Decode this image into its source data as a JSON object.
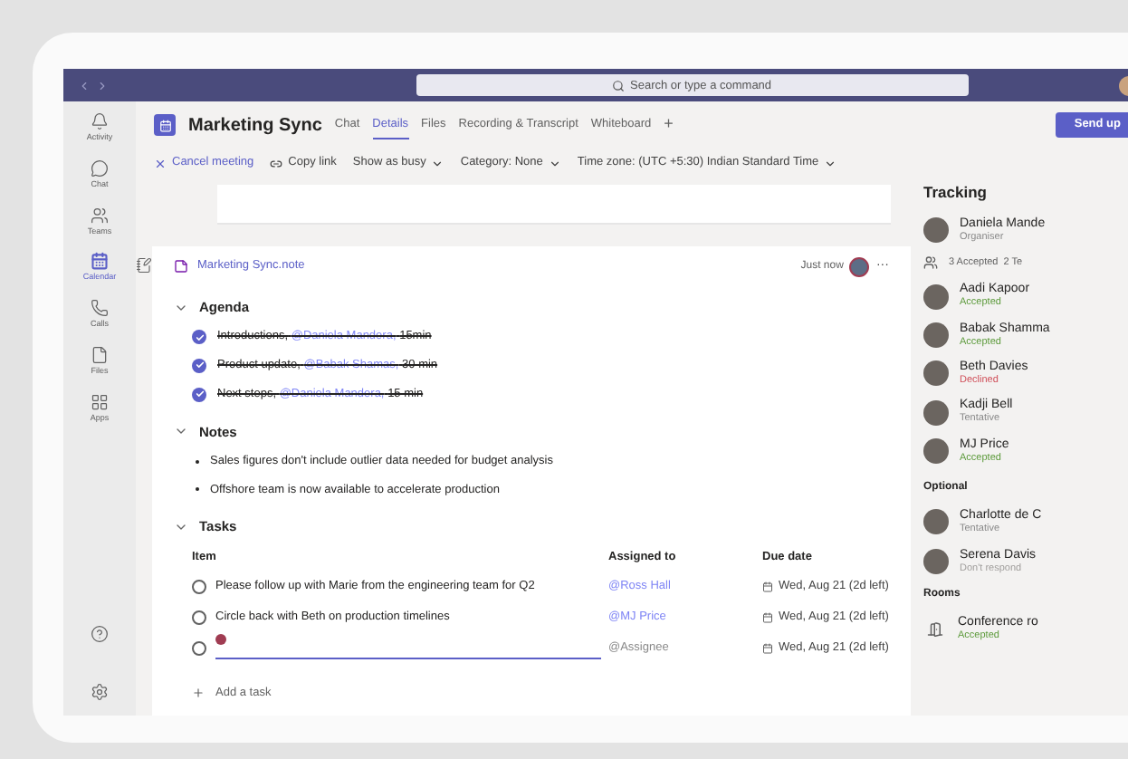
{
  "search": {
    "placeholder": "Search or type a command"
  },
  "rail": [
    {
      "label": "Activity",
      "selected": false
    },
    {
      "label": "Chat",
      "selected": false
    },
    {
      "label": "Teams",
      "selected": false
    },
    {
      "label": "Calendar",
      "selected": true
    },
    {
      "label": "Calls",
      "selected": false
    },
    {
      "label": "Files",
      "selected": false
    },
    {
      "label": "Apps",
      "selected": false
    }
  ],
  "meeting": {
    "title": "Marketing Sync",
    "tabs": [
      {
        "label": "Chat",
        "selected": false
      },
      {
        "label": "Details",
        "selected": true
      },
      {
        "label": "Files",
        "selected": false
      },
      {
        "label": "Recording & Transcript",
        "selected": false
      },
      {
        "label": "Whiteboard",
        "selected": false
      }
    ],
    "add_tab": "+",
    "send_button": "Send up"
  },
  "toolbar": [
    {
      "kind": "cancel",
      "label": "Cancel meeting"
    },
    {
      "kind": "link",
      "label": "Copy link"
    },
    {
      "kind": "dropdown",
      "label": "Show as busy"
    },
    {
      "kind": "dropdown",
      "label": "Category: None"
    },
    {
      "kind": "dropdown",
      "label": "Time zone: (UTC +5:30) Indian Standard Time"
    }
  ],
  "note": {
    "file": "Marketing Sync.note",
    "time": "Just now",
    "more": "···",
    "agenda": {
      "title": "Agenda",
      "expanded": true,
      "items": [
        {
          "label": "Introductions,",
          "mention": "@Daniela Mandera,",
          "duration": "15min",
          "done": true
        },
        {
          "label": "Product update,",
          "mention": "@Babak Shamas,",
          "duration": "30 min",
          "done": true
        },
        {
          "label": "Next steps,",
          "mention": "@Daniela Mandera,",
          "duration": "15 min",
          "done": true
        }
      ]
    },
    "notes": {
      "title": "Notes",
      "expanded": true,
      "items": [
        "Sales figures don't include outlier data needed for budget analysis",
        "Offshore team is now available to accelerate production"
      ]
    },
    "tasks": {
      "title": "Tasks",
      "expanded": true,
      "columns": [
        "Item",
        "Assigned to",
        "Due date"
      ],
      "rows": [
        {
          "kind": "task",
          "checked": false,
          "item": "Please follow up with Marie from the engineering team for Q2",
          "assignee": "@Ross Hall",
          "due": "Wed, Aug 21 (2d left)"
        },
        {
          "kind": "task",
          "checked": false,
          "item": "Circle back with Beth on production timelines",
          "assignee": "@MJ Price",
          "due": "Wed, Aug 21 (2d left)"
        },
        {
          "kind": "new",
          "checked": false,
          "assignee": "@Assignee",
          "due": "Wed, Aug 21 (2d left)"
        }
      ],
      "add": "Add a task"
    }
  },
  "tracking": {
    "title": "Tracking",
    "organiser": {
      "name": "Daniela Mande",
      "role": "Organiser"
    },
    "summary": "3 Accepted  2 Te",
    "required": [
      {
        "name": "Aadi Kapoor",
        "status": "Accepted",
        "kind": "accepted"
      },
      {
        "name": "Babak Shamma",
        "status": "Accepted",
        "kind": "accepted"
      },
      {
        "name": "Beth Davies",
        "status": "Declined",
        "kind": "declined"
      },
      {
        "name": "Kadji Bell",
        "status": "Tentative",
        "kind": "tentative"
      },
      {
        "name": "MJ Price",
        "status": "Accepted",
        "kind": "accepted"
      }
    ],
    "optional_title": "Optional",
    "optional": [
      {
        "name": "Charlotte de C",
        "status": "Tentative",
        "kind": "tentative"
      },
      {
        "name": "Serena Davis",
        "status": "Don't respond",
        "kind": "none"
      }
    ],
    "rooms_title": "Rooms",
    "rooms": [
      {
        "name": "Conference ro",
        "status": "Accepted",
        "kind": "accepted"
      }
    ]
  }
}
